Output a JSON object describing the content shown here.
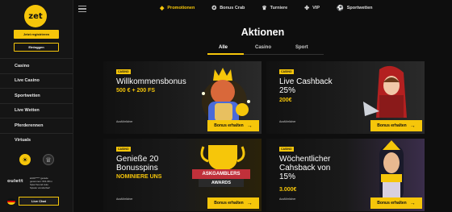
{
  "brand": {
    "logo": "zet",
    "logo_sub": "CASINO",
    "accent": "#f6c60a"
  },
  "sidebar": {
    "register_label": "Jetzt registrieren",
    "login_label": "Einloggen",
    "items": [
      {
        "label": "Casino"
      },
      {
        "label": "Live Casino"
      },
      {
        "label": "Sportwetten"
      },
      {
        "label": "Live Wetten"
      },
      {
        "label": "Pferderennen"
      },
      {
        "label": "Virtuals"
      }
    ],
    "promo_logo": "oulett",
    "promo_text_1": "£100***** gerade",
    "promo_text_2": "gewonnen: €31.68 in",
    "promo_text_3": "Spiel Sound Auto",
    "promo_text_4": "Spieler wunderbar!",
    "live_chat_label": "Live Chat"
  },
  "topnav": {
    "items": [
      {
        "label": "Promotionen",
        "icon": "diamond-icon",
        "active": true
      },
      {
        "label": "Bonus Crab",
        "icon": "crab-icon"
      },
      {
        "label": "Turniere",
        "icon": "trophy-icon"
      },
      {
        "label": "VIP",
        "icon": "vip-icon"
      },
      {
        "label": "Sportwetten",
        "icon": "soccer-ball-icon"
      }
    ]
  },
  "main": {
    "title": "Aktionen",
    "tabs": [
      {
        "label": "Alle",
        "active": true
      },
      {
        "label": "Casino"
      },
      {
        "label": "Sport"
      }
    ]
  },
  "cards": [
    {
      "tag": "CASINO",
      "title": "Willkommensbonus",
      "sub": "500 € + 200 FS",
      "more": "Ausführlicher",
      "button": "Bonus erhalten"
    },
    {
      "tag": "CASINO",
      "title": "Live Cashback",
      "title2": "25%",
      "sub": "200€",
      "more": "Ausführlicher",
      "button": "Bonus erhalten"
    },
    {
      "tag": "CASINO",
      "title": "Genieße 20",
      "title2": "Bonusspins",
      "sub": "NOMINIERE UNS",
      "more": "Ausführlicher",
      "button": "Bonus erhalten",
      "badge_top": "ASKGAMBLERS",
      "badge_bottom": "AWARDS"
    },
    {
      "tag": "CASINO",
      "title": "Wöchentlicher",
      "title2": "Cahsback von",
      "title3": "15%",
      "sub": "3.000€",
      "more": "Ausführlicher",
      "button": "Bonus erhalten"
    }
  ]
}
